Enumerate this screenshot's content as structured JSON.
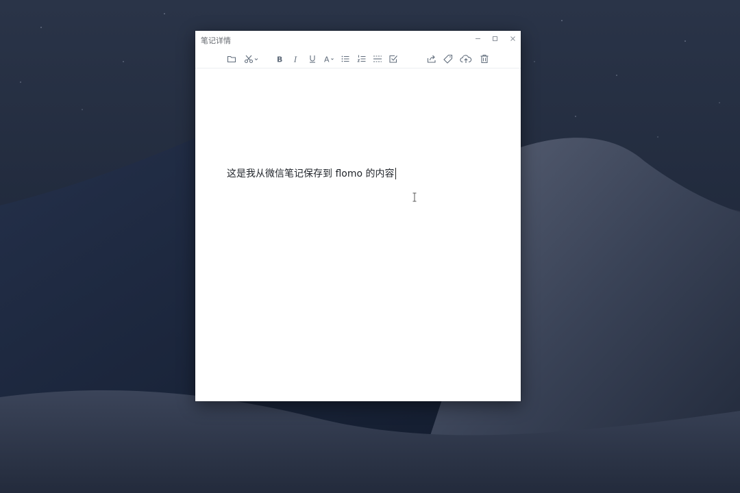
{
  "window": {
    "title": "笔记详情",
    "controls": [
      "minimize-icon",
      "maximize-icon",
      "close-icon"
    ]
  },
  "toolbar": {
    "items": [
      {
        "icon": "folder-icon"
      },
      {
        "icon": "scissors-icon"
      },
      {
        "icon": "bold-icon",
        "glyph": "B"
      },
      {
        "icon": "italic-icon",
        "glyph": "I"
      },
      {
        "icon": "underline-icon",
        "glyph": "U"
      },
      {
        "icon": "font-color-icon",
        "glyph": "A"
      },
      {
        "icon": "bullet-list-icon"
      },
      {
        "icon": "numbered-list-icon"
      },
      {
        "icon": "divider-icon"
      },
      {
        "icon": "checkbox-icon"
      },
      {
        "icon": "share-icon"
      },
      {
        "icon": "tag-icon"
      },
      {
        "icon": "cloud-upload-icon"
      },
      {
        "icon": "trash-icon"
      }
    ]
  },
  "editor": {
    "text": "这是我从微信笔记保存到 flomo 的内容"
  },
  "colors": {
    "icon": "#5f6b7a",
    "background_sky": "#1d2638",
    "text": "#1f2329"
  }
}
